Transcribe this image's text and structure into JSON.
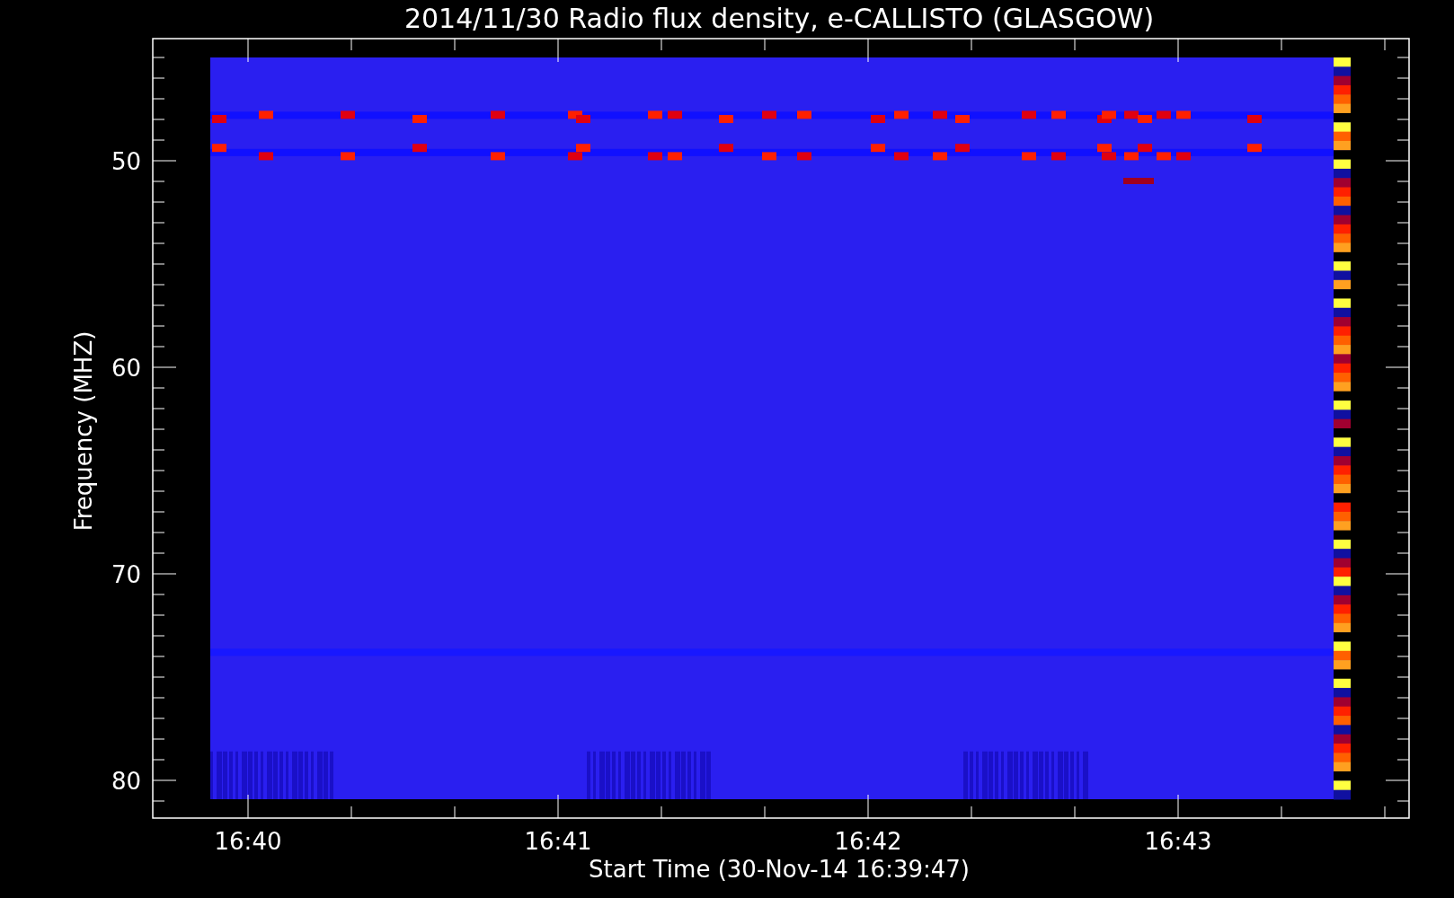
{
  "title": "2014/11/30  Radio flux density, e-CALLISTO (GLASGOW)",
  "y_axis": {
    "label": "Frequency (MHZ)",
    "ticks": [
      "50",
      "60",
      "70",
      "80"
    ]
  },
  "x_axis": {
    "label": "Start Time (30-Nov-14 16:39:47)",
    "ticks": [
      "16:40",
      "16:41",
      "16:42",
      "16:43"
    ]
  }
}
